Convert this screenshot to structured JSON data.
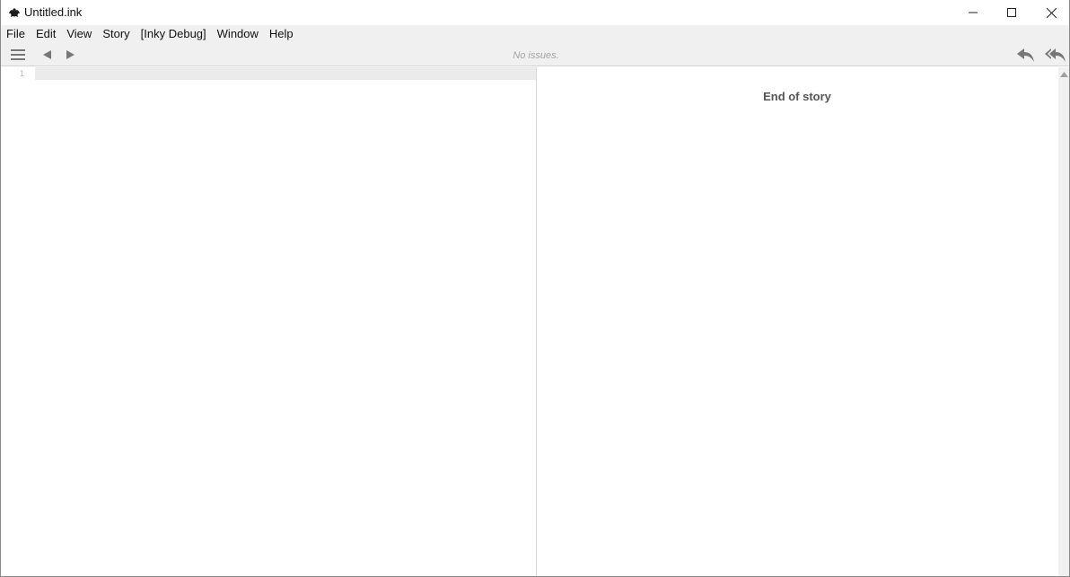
{
  "window": {
    "title": "Untitled.ink",
    "icon": "inky-app-icon",
    "controls": [
      "minimize-icon",
      "maximize-icon",
      "close-icon"
    ]
  },
  "menubar": {
    "items": [
      {
        "label": "File"
      },
      {
        "label": "Edit"
      },
      {
        "label": "View"
      },
      {
        "label": "Story"
      },
      {
        "label": "[Inky Debug]"
      },
      {
        "label": "Window"
      },
      {
        "label": "Help"
      }
    ]
  },
  "toolbar": {
    "status": "No issues.",
    "icons": [
      "hamburger-menu-icon",
      "back-arrow-icon",
      "forward-arrow-icon",
      "rewind-one-icon",
      "rewind-all-icon"
    ]
  },
  "editor": {
    "line_numbers": [
      "1"
    ],
    "content": ""
  },
  "player": {
    "end_text": "End of story"
  },
  "colors": {
    "chrome_bg": "#f0f0f0",
    "status_text": "#a3a3a3",
    "active_line": "#ebebeb",
    "icon_gray": "#777777"
  }
}
